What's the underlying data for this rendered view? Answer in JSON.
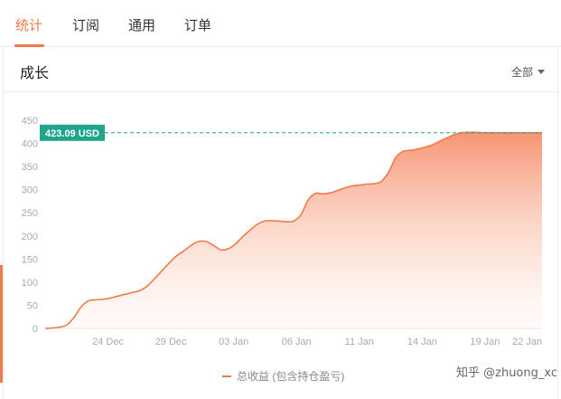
{
  "tabs": [
    {
      "label": "统计",
      "active": true
    },
    {
      "label": "订阅",
      "active": false
    },
    {
      "label": "通用",
      "active": false
    },
    {
      "label": "订单",
      "active": false
    }
  ],
  "card": {
    "title": "成长",
    "filter_label": "全部"
  },
  "watermark": "知乎 @zhuong_xc",
  "colors": {
    "accent": "#f07a4a",
    "badge": "#1fa58c",
    "reference_line": "#2aa090"
  },
  "chart_data": {
    "type": "area",
    "title": "",
    "xlabel": "",
    "ylabel": "",
    "ylim": [
      0,
      450
    ],
    "yticks": [
      0,
      50,
      100,
      150,
      200,
      250,
      300,
      350,
      400,
      450
    ],
    "xlim": [
      0,
      34
    ],
    "xtick_positions": [
      4,
      9,
      14,
      19,
      24,
      29,
      34
    ],
    "xtick_labels": [
      "24 Dec",
      "29 Dec",
      "03 Jan",
      "06 Jan",
      "11 Jan",
      "14 Jan",
      "19 Jan",
      "22 Jan"
    ],
    "xtick_label_positions": [
      4.3,
      8.6,
      12.9,
      17.2,
      21.5,
      25.8,
      30.1,
      34
    ],
    "current_value_label": "423.09 USD",
    "current_value": 423.09,
    "legend": "总收益 (包含持仓盈亏)",
    "legend_position": "bottom",
    "grid": false,
    "series": [
      {
        "name": "总收益 (包含持仓盈亏)",
        "x": [
          0,
          0.5,
          1,
          1.5,
          2,
          2.5,
          3,
          3.5,
          4,
          4.5,
          5,
          5.5,
          6,
          6.5,
          7,
          7.5,
          8,
          8.5,
          9,
          9.5,
          10,
          10.5,
          11,
          11.5,
          12,
          12.5,
          13,
          13.5,
          14,
          14.5,
          15,
          15.5,
          16,
          16.5,
          17,
          17.5,
          18,
          18.5,
          19,
          19.5,
          20,
          20.5,
          21,
          21.5,
          22,
          22.5,
          23,
          23.5,
          24,
          24.5,
          25,
          25.5,
          26,
          26.5,
          27,
          27.5,
          28,
          28.5,
          29,
          29.5,
          30,
          30.5,
          31,
          31.5,
          32,
          32.5,
          33,
          33.5,
          34
        ],
        "values": [
          0,
          1,
          3,
          8,
          25,
          48,
          60,
          62,
          63,
          66,
          70,
          74,
          78,
          82,
          92,
          108,
          125,
          142,
          157,
          168,
          180,
          188,
          188,
          180,
          170,
          172,
          182,
          198,
          212,
          225,
          232,
          233,
          232,
          231,
          232,
          246,
          278,
          292,
          291,
          293,
          298,
          304,
          308,
          310,
          312,
          313,
          318,
          338,
          370,
          383,
          385,
          388,
          392,
          397,
          405,
          412,
          419,
          423,
          424,
          424,
          423,
          423,
          423,
          423,
          423,
          423,
          423,
          423,
          423
        ]
      }
    ]
  }
}
